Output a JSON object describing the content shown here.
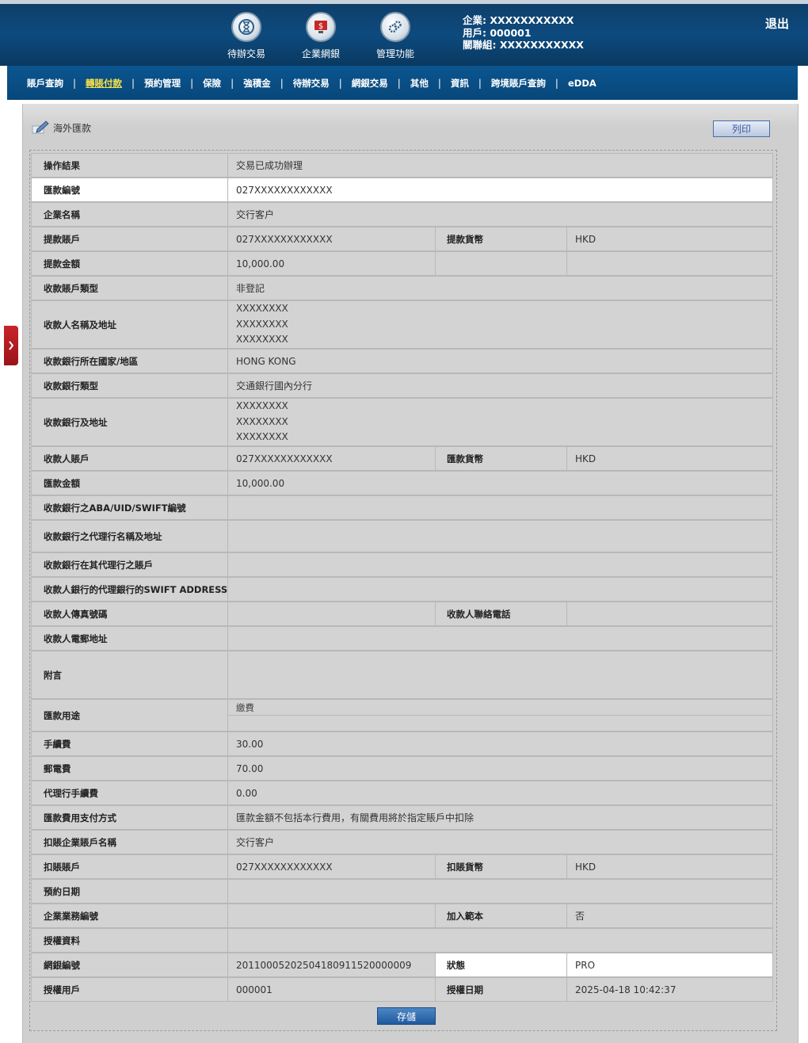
{
  "header": {
    "nav": [
      {
        "label": "待辦交易",
        "icon": "hourglass-icon"
      },
      {
        "label": "企業網銀",
        "icon": "monitor-dollar-icon"
      },
      {
        "label": "管理功能",
        "icon": "gears-icon"
      }
    ],
    "user_lines": [
      "企業: XXXXXXXXXXX",
      "用戶: 000001",
      "關聯組: XXXXXXXXXXX"
    ],
    "logout": "退出"
  },
  "menu": [
    {
      "label": "賬戶查詢",
      "active": false
    },
    {
      "label": "轉賬付款",
      "active": true
    },
    {
      "label": "預約管理",
      "active": false
    },
    {
      "label": "保險",
      "active": false
    },
    {
      "label": "強積金",
      "active": false
    },
    {
      "label": "待辦交易",
      "active": false
    },
    {
      "label": "網銀交易",
      "active": false
    },
    {
      "label": "其他",
      "active": false
    },
    {
      "label": "資訊",
      "active": false
    },
    {
      "label": "跨境賬戶查詢",
      "active": false
    },
    {
      "label": "eDDA",
      "active": false
    }
  ],
  "page": {
    "title": "海外匯款",
    "print_label": "列印",
    "save_label": "存儲"
  },
  "rows": [
    {
      "label": "操作結果",
      "value": "交易已成功辦理"
    },
    {
      "label": "匯款編號",
      "value": "027XXXXXXXXXXXX"
    },
    {
      "label": "企業名稱",
      "value": "交行客户"
    },
    {
      "label": "提款賬戶",
      "value": "027XXXXXXXXXXXX",
      "label2": "提款貨幣",
      "value2": "HKD"
    },
    {
      "label": "提款金額",
      "value": "10,000.00",
      "label2": "",
      "value2": ""
    },
    {
      "label": "收款賬戶類型",
      "value": "非登記"
    },
    {
      "label": "收款人名稱及地址",
      "lines": [
        "XXXXXXXX",
        "XXXXXXXX",
        "XXXXXXXX"
      ]
    },
    {
      "label": "收款銀行所在國家/地區",
      "value": "HONG KONG"
    },
    {
      "label": "收款銀行類型",
      "value": "交通銀行國內分行"
    },
    {
      "label": "收款銀行及地址",
      "lines": [
        "XXXXXXXX",
        "XXXXXXXX",
        "XXXXXXXX"
      ]
    },
    {
      "label": "收款人賬戶",
      "value": "027XXXXXXXXXXXX",
      "label2": "匯款貨幣",
      "value2": "HKD"
    },
    {
      "label": "匯款金額",
      "value": "10,000.00"
    },
    {
      "label": "收款銀行之ABA/UID/SWIFT編號",
      "value": ""
    },
    {
      "label": "收款銀行之代理行名稱及地址",
      "value": ""
    },
    {
      "label": "收款銀行在其代理行之賬戶",
      "value": ""
    },
    {
      "label": "收款人銀行的代理銀行的SWIFT ADDRESS",
      "value": ""
    },
    {
      "label": "收款人傳真號碼",
      "value": "",
      "label2": "收款人聯絡電話",
      "value2": ""
    },
    {
      "label": "收款人電郵地址",
      "value": ""
    },
    {
      "label": "附言",
      "value": ""
    },
    {
      "label": "匯款用途",
      "value": "繳費"
    },
    {
      "label": "手續費",
      "value": "30.00"
    },
    {
      "label": "郵電費",
      "value": "70.00"
    },
    {
      "label": "代理行手續費",
      "value": "0.00"
    },
    {
      "label": "匯款費用支付方式",
      "value": "匯款金額不包括本行費用，有關費用將於指定賬戶中扣除"
    },
    {
      "label": "扣賬企業賬戶名稱",
      "value": "交行客户"
    },
    {
      "label": "扣賬賬戶",
      "value": "027XXXXXXXXXXXX",
      "label2": "扣賬貨幣",
      "value2": "HKD"
    },
    {
      "label": "預約日期",
      "value": ""
    },
    {
      "label": "企業業務編號",
      "value": "",
      "label2": "加入範本",
      "value2": "否"
    },
    {
      "label": "授權資料",
      "value": ""
    },
    {
      "label": "網銀編號",
      "value": "20110005202504180911520000009",
      "label2": "狀態",
      "value2": "PRO"
    },
    {
      "label": "授權用戶",
      "value": "000001",
      "label2": "授權日期",
      "value2": "2025-04-18 10:42:37"
    }
  ]
}
